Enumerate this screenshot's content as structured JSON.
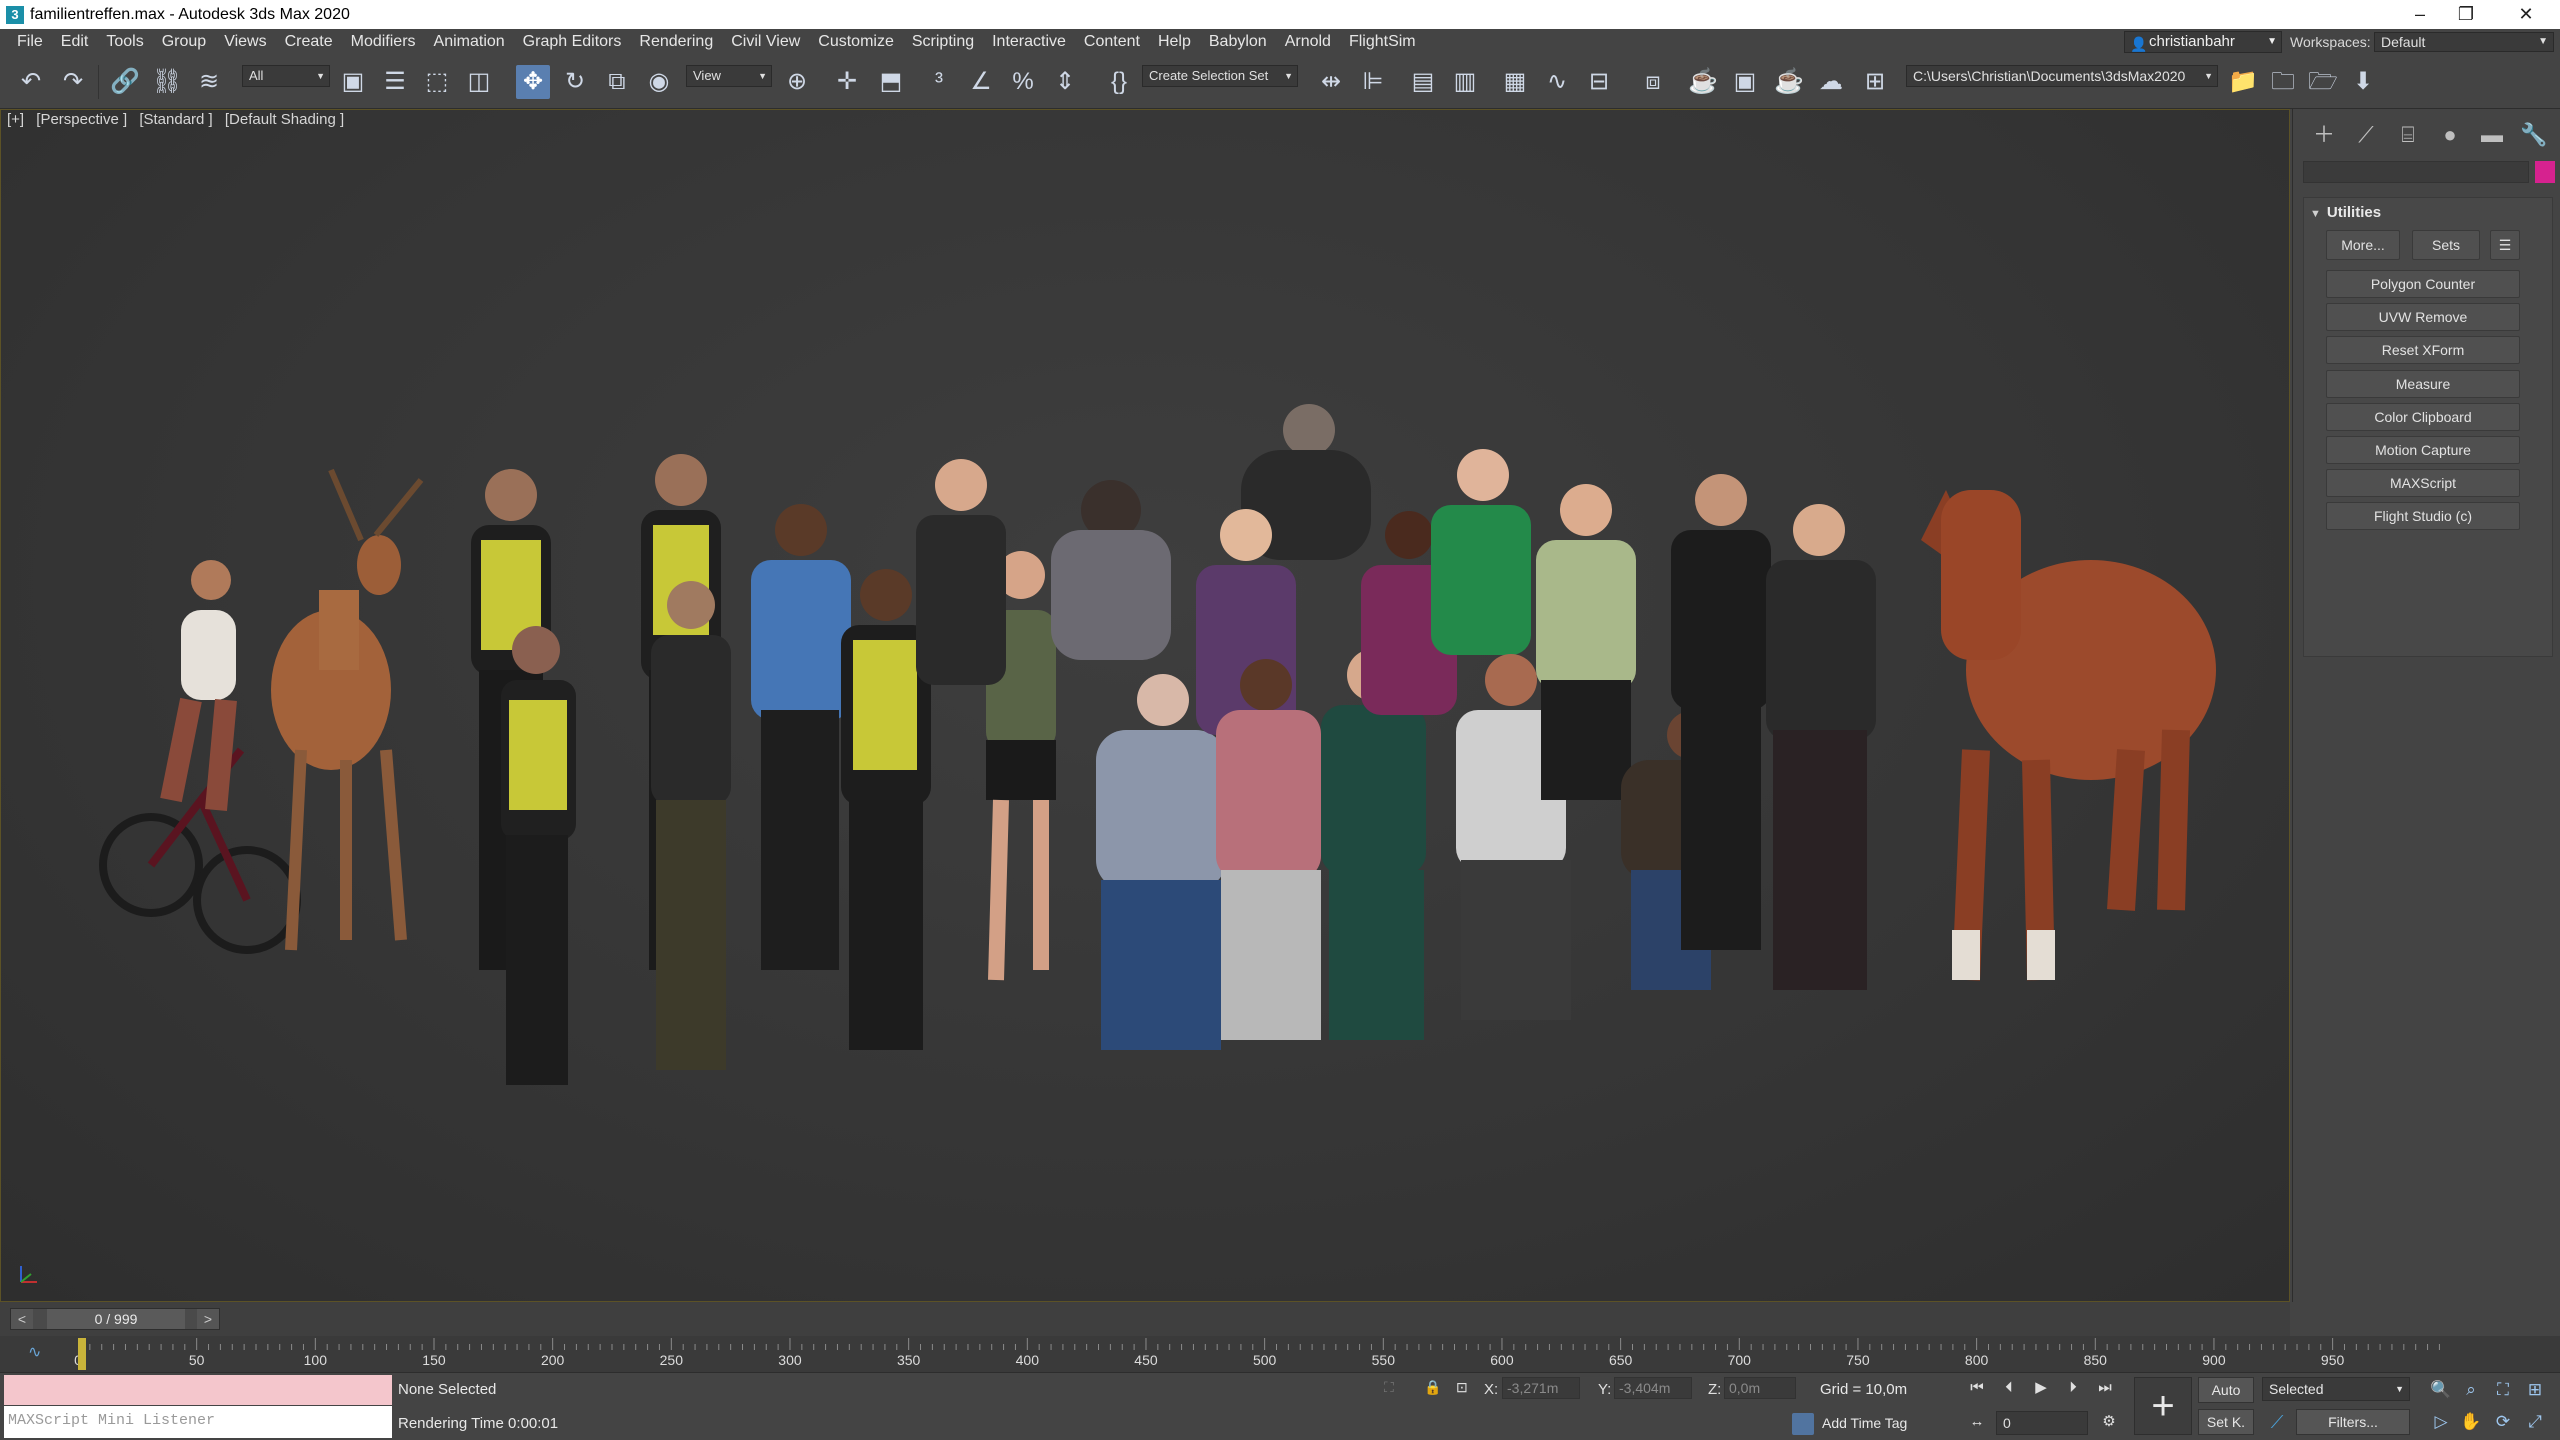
{
  "window": {
    "title": "familientreffen.max - Autodesk 3ds Max 2020",
    "app_icon": "3ds-max-icon",
    "controls": [
      "–",
      "❐",
      "✕"
    ]
  },
  "menu": {
    "items": [
      "File",
      "Edit",
      "Tools",
      "Group",
      "Views",
      "Create",
      "Modifiers",
      "Animation",
      "Graph Editors",
      "Rendering",
      "Civil View",
      "Customize",
      "Scripting",
      "Interactive",
      "Content",
      "Help",
      "Babylon",
      "Arnold",
      "FlightSim"
    ],
    "user": "christianbahr",
    "workspaces_label": "Workspaces:",
    "workspace": "Default"
  },
  "toolbar": {
    "selection_filter": "All",
    "ref_coord": "View",
    "named_selection": "Create Selection Set",
    "project_path": "C:\\Users\\Christian\\Documents\\3dsMax2020"
  },
  "viewport": {
    "labels": [
      "[+]",
      "[Perspective ]",
      "[Standard ]",
      "[Default Shading ]"
    ],
    "background": "#383838",
    "border_color": "#5c5226"
  },
  "command_panel": {
    "rollout_title": "Utilities",
    "more_button": "More...",
    "sets_button": "Sets",
    "utilities": [
      "Polygon Counter",
      "UVW Remove",
      "Reset XForm",
      "Measure",
      "Color Clipboard",
      "Motion Capture",
      "MAXScript",
      "Flight Studio (c)"
    ],
    "object_color": "#d6228f"
  },
  "timeslider": {
    "frame_display": "0 / 999",
    "prev": "<",
    "next": ">"
  },
  "trackbar": {
    "ticks": [
      "0",
      "50",
      "100",
      "150",
      "200",
      "250",
      "300",
      "350",
      "400",
      "450",
      "500",
      "550",
      "600",
      "650",
      "700",
      "750",
      "800",
      "850",
      "900",
      "950"
    ],
    "playhead_color": "#c9b43a"
  },
  "status": {
    "maxscript_placeholder": "MAXScript Mini Listener",
    "selection": "None Selected",
    "rendering_time": "Rendering Time  0:00:01",
    "x_label": "X:",
    "x_value": "-3,271m",
    "y_label": "Y:",
    "y_value": "-3,404m",
    "z_label": "Z:",
    "z_value": "0,0m",
    "grid": "Grid = 10,0m",
    "add_time_tag": "Add Time Tag",
    "auto_key": "Auto",
    "set_key": "Set K.",
    "key_filter": "Selected",
    "filters": "Filters...",
    "current_frame": "0"
  }
}
